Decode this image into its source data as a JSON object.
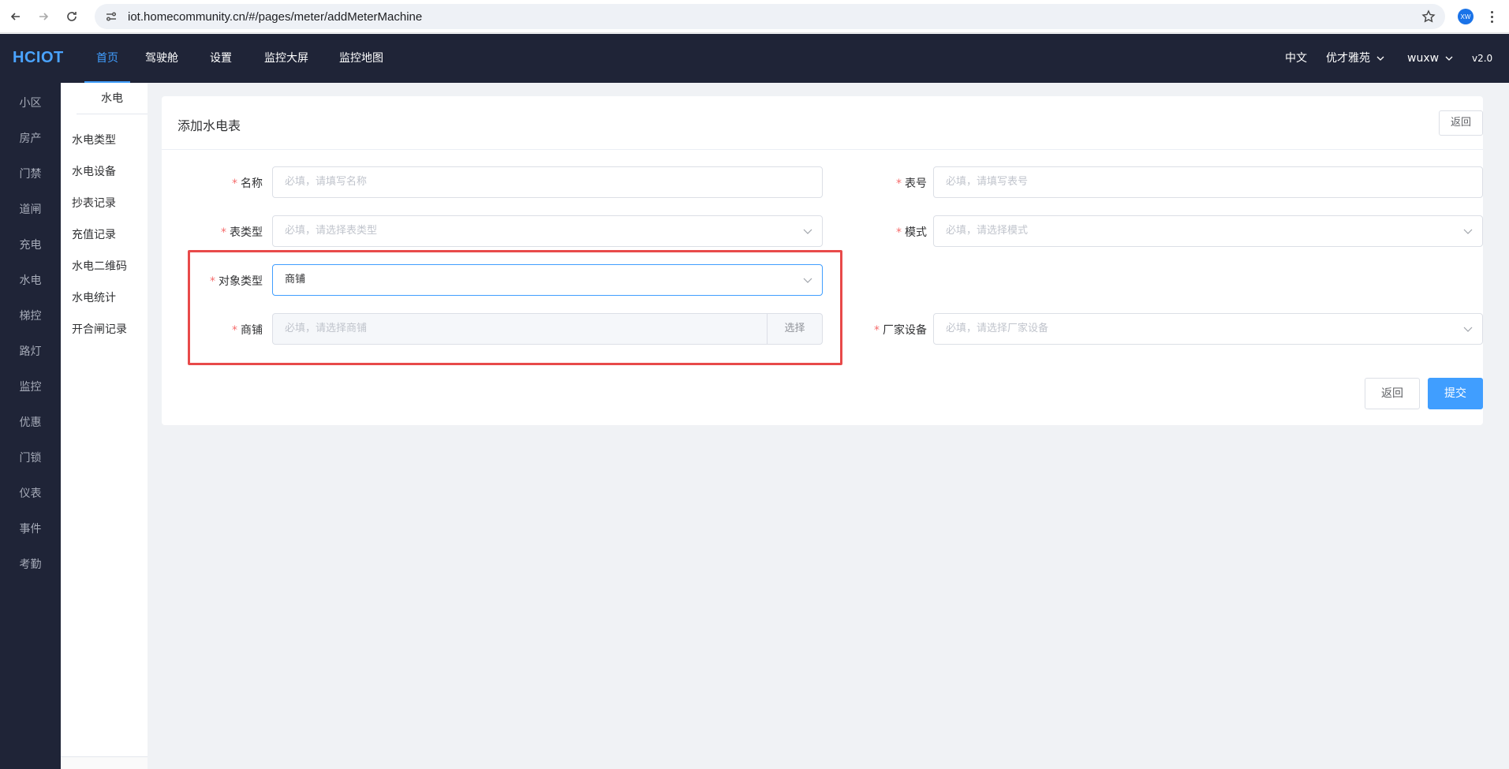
{
  "browser": {
    "url": "iot.homecommunity.cn/#/pages/meter/addMeterMachine",
    "profile_initials": "XW"
  },
  "topnav": {
    "logo": "HCIOT",
    "menu": [
      {
        "label": "首页"
      },
      {
        "label": "驾驶舱"
      },
      {
        "label": "设置"
      },
      {
        "label": "监控大屏"
      },
      {
        "label": "监控地图"
      }
    ],
    "language": "中文",
    "community": "优才雅苑",
    "user": "wuxw",
    "version": "v2.0"
  },
  "sidebar": {
    "items": [
      {
        "label": "小区"
      },
      {
        "label": "房产"
      },
      {
        "label": "门禁"
      },
      {
        "label": "道闸"
      },
      {
        "label": "充电"
      },
      {
        "label": "水电"
      },
      {
        "label": "梯控"
      },
      {
        "label": "路灯"
      },
      {
        "label": "监控"
      },
      {
        "label": "优惠"
      },
      {
        "label": "门锁"
      },
      {
        "label": "仪表"
      },
      {
        "label": "事件"
      },
      {
        "label": "考勤"
      }
    ]
  },
  "submenu": {
    "title": "水电",
    "items": [
      {
        "label": "水电类型"
      },
      {
        "label": "水电设备"
      },
      {
        "label": "抄表记录"
      },
      {
        "label": "充值记录"
      },
      {
        "label": "水电二维码"
      },
      {
        "label": "水电统计"
      },
      {
        "label": "开合闸记录"
      }
    ]
  },
  "form": {
    "title": "添加水电表",
    "header_back": "返回",
    "fields": {
      "name": {
        "label": "名称",
        "placeholder": "必填，请填写名称"
      },
      "meter_no": {
        "label": "表号",
        "placeholder": "必填，请填写表号"
      },
      "meter_type": {
        "label": "表类型",
        "placeholder": "必填，请选择表类型"
      },
      "mode": {
        "label": "模式",
        "placeholder": "必填，请选择模式"
      },
      "object_type": {
        "label": "对象类型",
        "value": "商铺"
      },
      "shop": {
        "label": "商铺",
        "placeholder": "必填，请选择商铺",
        "button": "选择"
      },
      "vendor_device": {
        "label": "厂家设备",
        "placeholder": "必填，请选择厂家设备"
      }
    },
    "back_button": "返回",
    "submit_button": "提交"
  }
}
